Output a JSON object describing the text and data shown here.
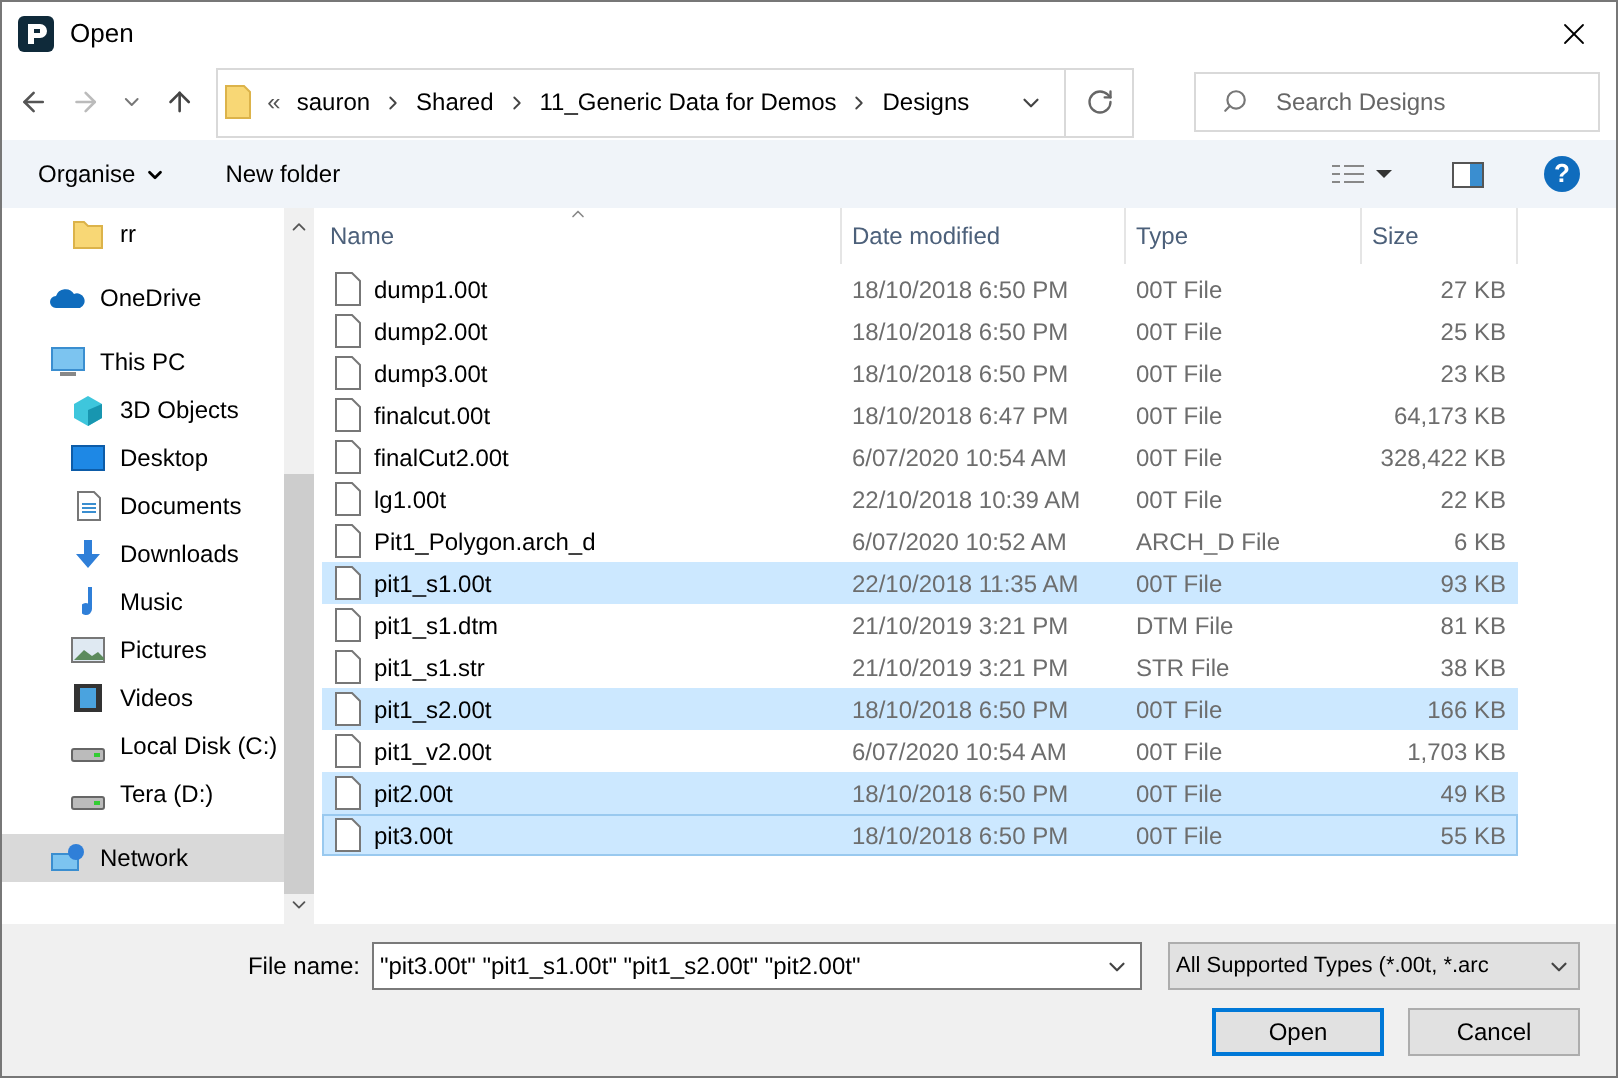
{
  "window": {
    "title": "Open"
  },
  "address": {
    "overflow": "«",
    "crumbs": [
      "sauron",
      "Shared",
      "11_Generic Data for Demos",
      "Designs"
    ]
  },
  "search": {
    "placeholder": "Search Designs"
  },
  "toolbar": {
    "organise": "Organise",
    "new_folder": "New folder",
    "help": "?"
  },
  "sidebar": {
    "items": [
      {
        "label": "rr",
        "kind": "folder",
        "selected": false
      },
      {
        "label": "OneDrive",
        "kind": "cloud",
        "selected": false
      },
      {
        "label": "This PC",
        "kind": "pc",
        "selected": false,
        "children": [
          {
            "label": "3D Objects",
            "kind": "cube",
            "selected": false
          },
          {
            "label": "Desktop",
            "kind": "desktop",
            "selected": false
          },
          {
            "label": "Documents",
            "kind": "document",
            "selected": false
          },
          {
            "label": "Downloads",
            "kind": "download",
            "selected": false
          },
          {
            "label": "Music",
            "kind": "music",
            "selected": false
          },
          {
            "label": "Pictures",
            "kind": "pictures",
            "selected": false
          },
          {
            "label": "Videos",
            "kind": "videos",
            "selected": false
          },
          {
            "label": "Local Disk (C:)",
            "kind": "disk",
            "selected": false
          },
          {
            "label": "Tera (D:)",
            "kind": "disk",
            "selected": false
          }
        ]
      },
      {
        "label": "Network",
        "kind": "network",
        "selected": true
      }
    ]
  },
  "table": {
    "columns": [
      "Name",
      "Date modified",
      "Type",
      "Size"
    ],
    "rows": [
      {
        "name": "dump1.00t",
        "date": "18/10/2018 6:50 PM",
        "type": "00T File",
        "size": "27 KB",
        "selected": false,
        "focused": false
      },
      {
        "name": "dump2.00t",
        "date": "18/10/2018 6:50 PM",
        "type": "00T File",
        "size": "25 KB",
        "selected": false,
        "focused": false
      },
      {
        "name": "dump3.00t",
        "date": "18/10/2018 6:50 PM",
        "type": "00T File",
        "size": "23 KB",
        "selected": false,
        "focused": false
      },
      {
        "name": "finalcut.00t",
        "date": "18/10/2018 6:47 PM",
        "type": "00T File",
        "size": "64,173 KB",
        "selected": false,
        "focused": false
      },
      {
        "name": "finalCut2.00t",
        "date": "6/07/2020 10:54 AM",
        "type": "00T File",
        "size": "328,422 KB",
        "selected": false,
        "focused": false
      },
      {
        "name": "lg1.00t",
        "date": "22/10/2018 10:39 AM",
        "type": "00T File",
        "size": "22 KB",
        "selected": false,
        "focused": false
      },
      {
        "name": "Pit1_Polygon.arch_d",
        "date": "6/07/2020 10:52 AM",
        "type": "ARCH_D File",
        "size": "6 KB",
        "selected": false,
        "focused": false
      },
      {
        "name": "pit1_s1.00t",
        "date": "22/10/2018 11:35 AM",
        "type": "00T File",
        "size": "93 KB",
        "selected": true,
        "focused": false
      },
      {
        "name": "pit1_s1.dtm",
        "date": "21/10/2019 3:21 PM",
        "type": "DTM File",
        "size": "81 KB",
        "selected": false,
        "focused": false
      },
      {
        "name": "pit1_s1.str",
        "date": "21/10/2019 3:21 PM",
        "type": "STR File",
        "size": "38 KB",
        "selected": false,
        "focused": false
      },
      {
        "name": "pit1_s2.00t",
        "date": "18/10/2018 6:50 PM",
        "type": "00T File",
        "size": "166 KB",
        "selected": true,
        "focused": false
      },
      {
        "name": "pit1_v2.00t",
        "date": "6/07/2020 10:54 AM",
        "type": "00T File",
        "size": "1,703 KB",
        "selected": false,
        "focused": false
      },
      {
        "name": "pit2.00t",
        "date": "18/10/2018 6:50 PM",
        "type": "00T File",
        "size": "49 KB",
        "selected": true,
        "focused": false
      },
      {
        "name": "pit3.00t",
        "date": "18/10/2018 6:50 PM",
        "type": "00T File",
        "size": "55 KB",
        "selected": true,
        "focused": true
      }
    ]
  },
  "footer": {
    "file_name_label": "File name:",
    "file_name": "\"pit3.00t\" \"pit1_s1.00t\" \"pit1_s2.00t\" \"pit2.00t\"",
    "file_type": "All Supported Types (*.00t, *.arc",
    "buttons": [
      "Open",
      "Cancel"
    ]
  }
}
